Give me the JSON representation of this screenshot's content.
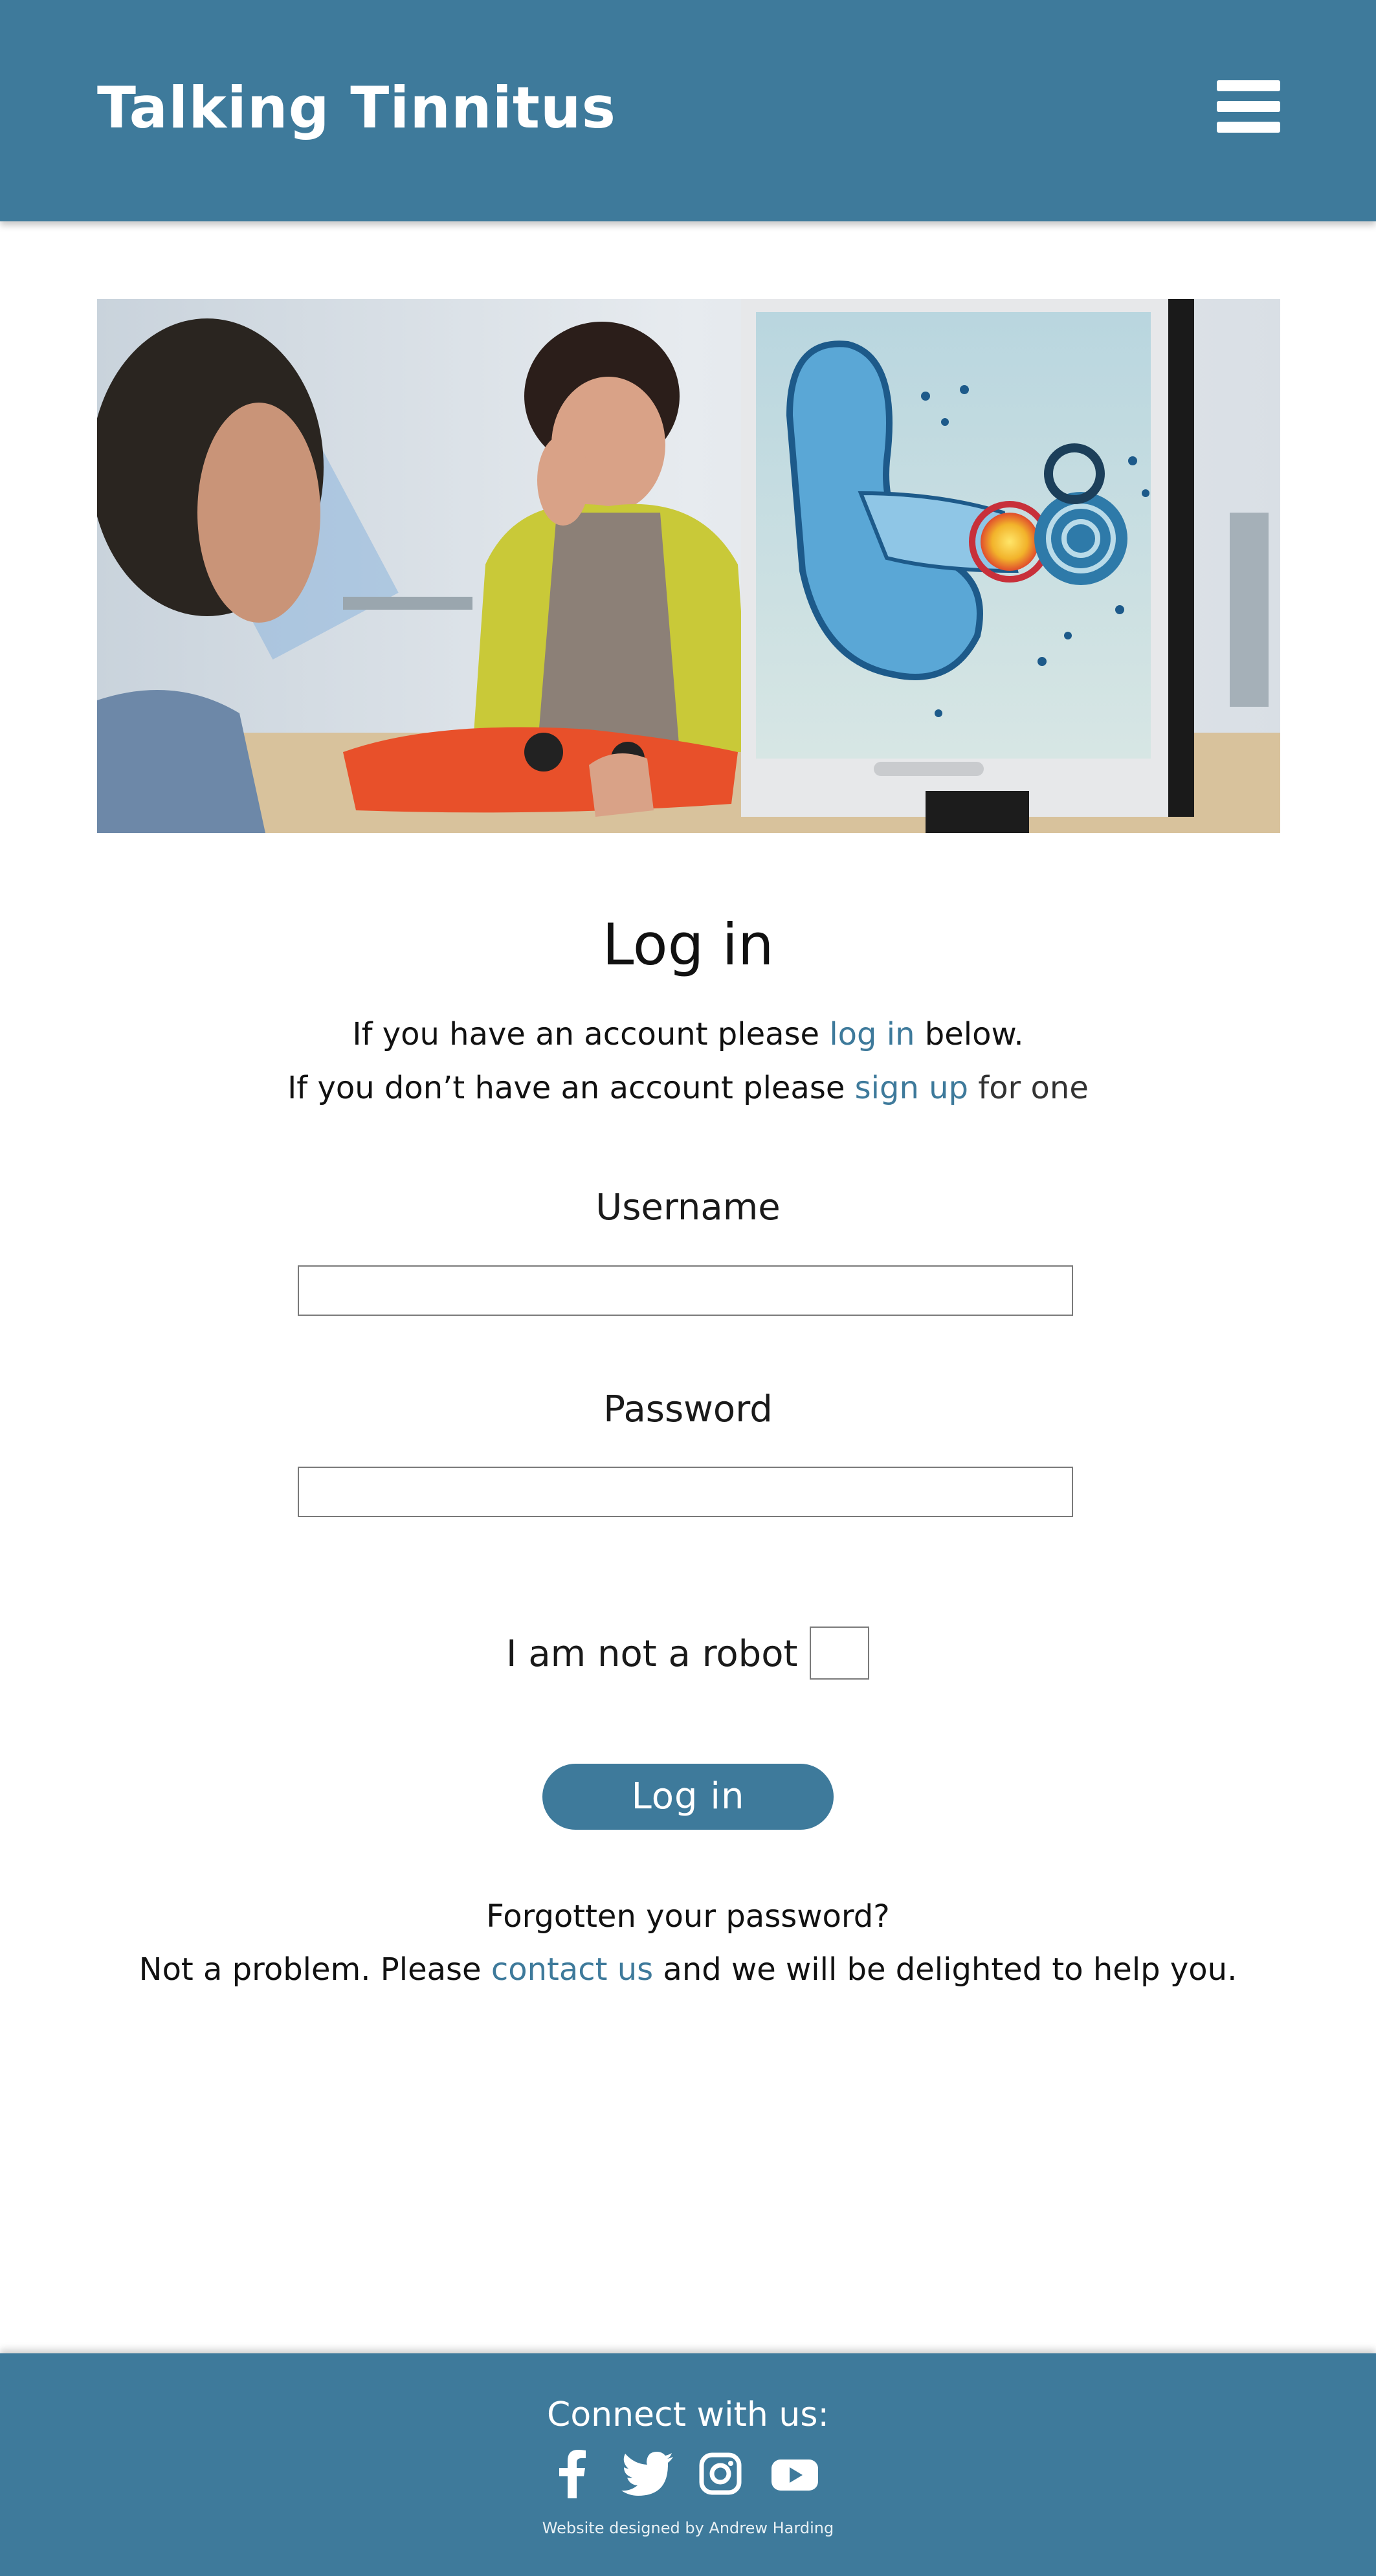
{
  "header": {
    "brand": "Talking Tinnitus",
    "menu_icon": "hamburger-menu-icon",
    "background_color": "#3e7a9b"
  },
  "hero": {
    "image": "audiologist-consultation-photo"
  },
  "login": {
    "title": "Log in",
    "intro_line1_before": "If you have an account please ",
    "intro_line1_link": "log in",
    "intro_line1_after": " below.",
    "intro_line2_before": "If you don’t have an account please ",
    "intro_line2_link": "sign up",
    "intro_line2_after": " for one",
    "username_label": "Username",
    "username_value": "",
    "password_label": "Password",
    "password_value": "",
    "robot_label": "I am not a robot",
    "robot_checked": false,
    "submit_label": "Log in",
    "forgot_line1": "Forgotten your password?",
    "forgot_line2_before": "Not a problem. Please ",
    "forgot_line2_link": "contact us",
    "forgot_line2_after": " and we will be delighted to help you.",
    "accent_color": "#3e7a9b"
  },
  "footer": {
    "title": "Connect with us:",
    "social": [
      {
        "icon": "facebook-icon"
      },
      {
        "icon": "twitter-icon"
      },
      {
        "icon": "instagram-icon"
      },
      {
        "icon": "youtube-icon"
      }
    ],
    "credit": "Website designed by Andrew Harding"
  }
}
